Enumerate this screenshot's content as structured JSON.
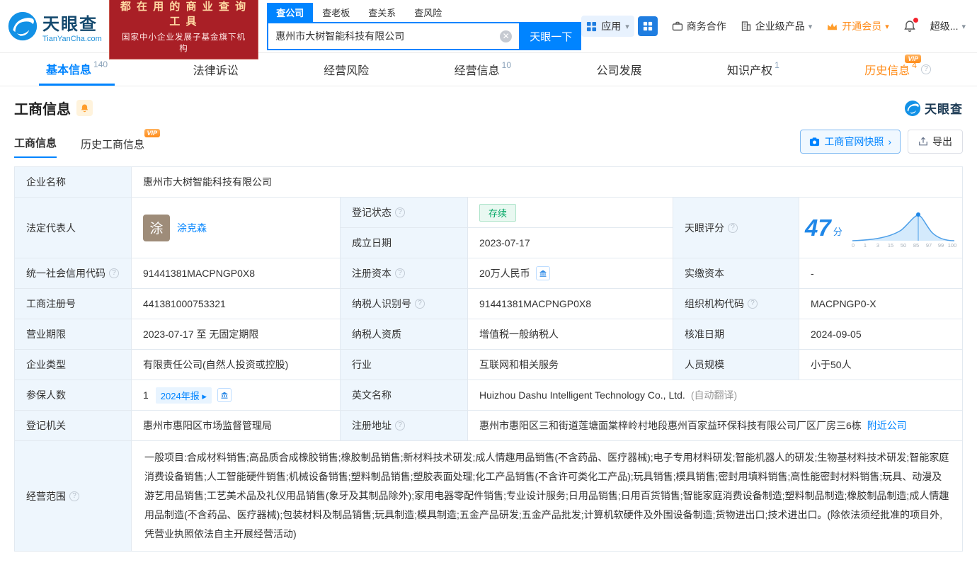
{
  "colors": {
    "accent": "#0084ff",
    "vip_orange": "#ff8c1a",
    "status_green": "#00a764",
    "banner_red": "#a91f26"
  },
  "icons": {
    "question_glyph": "?",
    "clear_glyph": "✕",
    "caret_down_glyph": "▾",
    "caret_right_glyph": "▸",
    "chevron_right_glyph": "›"
  },
  "brand": {
    "name": "天眼查",
    "domain": "TianYanCha.com",
    "banner_line1": "都 在 用 的 商 业 查 询 工 具",
    "banner_line2": "国家中小企业发展子基金旗下机构"
  },
  "search": {
    "tabs": [
      {
        "label": "查公司"
      },
      {
        "label": "查老板"
      },
      {
        "label": "查关系"
      },
      {
        "label": "查风险"
      }
    ],
    "value": "惠州市大树智能科技有限公司",
    "button_label": "天眼一下"
  },
  "top_menu": {
    "apps_label": "应用",
    "business_coop": "商务合作",
    "enterprise_products": "企业级产品",
    "vip_label": "开通会员",
    "super_label": "超级..."
  },
  "nav": {
    "items": [
      {
        "label": "基本信息",
        "count": "140"
      },
      {
        "label": "法律诉讼",
        "count": ""
      },
      {
        "label": "经营风险",
        "count": ""
      },
      {
        "label": "经营信息",
        "count": "10"
      },
      {
        "label": "公司发展",
        "count": ""
      },
      {
        "label": "知识产权",
        "count": "1"
      },
      {
        "label": "历史信息",
        "count": "4",
        "vip": "VIP"
      }
    ]
  },
  "section": {
    "title": "工商信息",
    "tab_current": "工商信息",
    "tab_history": "历史工商信息",
    "history_vip": "VIP",
    "snapshot_button": "工商官网快照",
    "export_button": "导出"
  },
  "fields": {
    "company_name": {
      "label": "企业名称",
      "value": "惠州市大树智能科技有限公司"
    },
    "legal_rep": {
      "label": "法定代表人",
      "avatar": "涂",
      "value": "涂克森"
    },
    "reg_status": {
      "label": "登记状态",
      "value": "存续"
    },
    "establish_date": {
      "label": "成立日期",
      "value": "2023-07-17"
    },
    "tyc_score": {
      "label": "天眼评分",
      "score": "47",
      "unit": "分"
    },
    "credit_code": {
      "label": "统一社会信用代码",
      "value": "91441381MACPNGP0X8"
    },
    "reg_capital": {
      "label": "注册资本",
      "value": "20万人民币"
    },
    "paid_capital": {
      "label": "实缴资本",
      "value": "-"
    },
    "reg_no": {
      "label": "工商注册号",
      "value": "441381000753321"
    },
    "taxpayer_no": {
      "label": "纳税人识别号",
      "value": "91441381MACPNGP0X8"
    },
    "org_code": {
      "label": "组织机构代码",
      "value": "MACPNGP0-X"
    },
    "biz_term": {
      "label": "营业期限",
      "value": "2023-07-17 至 无固定期限"
    },
    "taxpayer_quality": {
      "label": "纳税人资质",
      "value": "增值税一般纳税人"
    },
    "approve_date": {
      "label": "核准日期",
      "value": "2024-09-05"
    },
    "company_type": {
      "label": "企业类型",
      "value": "有限责任公司(自然人投资或控股)"
    },
    "industry": {
      "label": "行业",
      "value": "互联网和相关服务"
    },
    "staff_size": {
      "label": "人员规模",
      "value": "小于50人"
    },
    "insured_count": {
      "label": "参保人数",
      "value": "1",
      "report_tag": "2024年报"
    },
    "english_name": {
      "label": "英文名称",
      "value": "Huizhou Dashu Intelligent Technology Co., Ltd.",
      "note": "(自动翻译)"
    },
    "reg_authority": {
      "label": "登记机关",
      "value": "惠州市惠阳区市场监督管理局"
    },
    "reg_address": {
      "label": "注册地址",
      "value": "惠州市惠阳区三和街道莲塘面棠梓岭村地段惠州百家益环保科技有限公司厂区厂房三6栋",
      "nearby_link": "附近公司"
    },
    "biz_scope": {
      "label": "经营范围",
      "value": "一般项目:合成材料销售;高品质合成橡胶销售;橡胶制品销售;新材料技术研发;成人情趣用品销售(不含药品、医疗器械);电子专用材料研发;智能机器人的研发;生物基材料技术研发;智能家庭消费设备销售;人工智能硬件销售;机械设备销售;塑料制品销售;塑胶表面处理;化工产品销售(不含许可类化工产品);玩具销售;模具销售;密封用填料销售;高性能密封材料销售;玩具、动漫及游艺用品销售;工艺美术品及礼仪用品销售(象牙及其制品除外);家用电器零配件销售;专业设计服务;日用品销售;日用百货销售;智能家庭消费设备制造;塑料制品制造;橡胶制品制造;成人情趣用品制造(不含药品、医疗器械);包装材料及制品销售;玩具制造;模具制造;五金产品研发;五金产品批发;计算机软硬件及外围设备制造;货物进出口;技术进出口。(除依法须经批准的项目外,凭营业执照依法自主开展经营活动)"
    }
  },
  "score_chart": {
    "score": 47,
    "axis_labels": [
      "0",
      "1",
      "3",
      "15",
      "50",
      "85",
      "97",
      "99",
      "100"
    ]
  }
}
